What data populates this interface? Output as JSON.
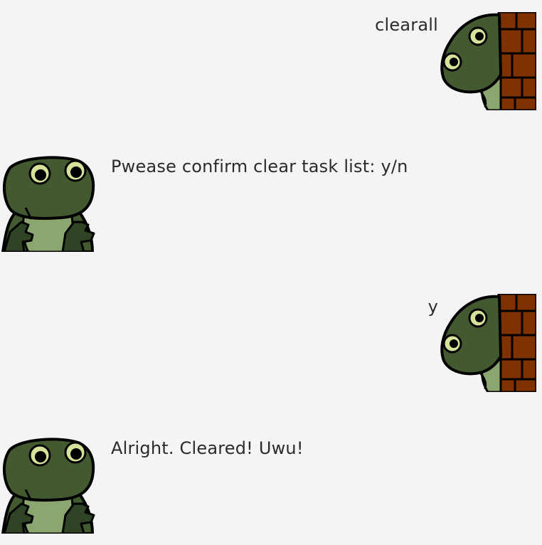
{
  "conversation": {
    "messages": [
      {
        "role": "user",
        "text": "clearall",
        "avatar_icon": "turtle-peeking-from-brick-wall-icon"
      },
      {
        "role": "bot",
        "text": "Pwease confirm clear task list: y/n",
        "avatar_icon": "turtle-bot-avatar-icon"
      },
      {
        "role": "user",
        "text": "y",
        "avatar_icon": "turtle-peeking-from-brick-wall-icon"
      },
      {
        "role": "bot",
        "text": "Alright. Cleared! Uwu!",
        "avatar_icon": "turtle-bot-avatar-icon"
      }
    ]
  },
  "colors": {
    "background": "#f4f4f4",
    "text": "#2b2b2b",
    "turtle_skin": "#435a31",
    "turtle_belly": "#8ca670",
    "turtle_eye": "#d6e29a",
    "brick": "#7f3200",
    "outline": "#000000"
  }
}
